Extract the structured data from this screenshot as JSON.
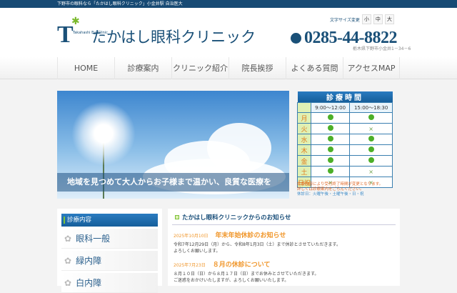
{
  "topbar": {
    "text": "下野市の眼科なら「たかはし眼科クリニック」小金井駅 自治医大"
  },
  "header": {
    "logo_letter": "T",
    "logo_small": "Takahashi EyeClinic",
    "clinic_name": "たかはし眼科クリニック",
    "font_size_label": "文字サイズ変更",
    "font_sizes": [
      "小",
      "中",
      "大"
    ],
    "phone": "0285-44-8822",
    "address": "栃木県下野市小金井1－34－6"
  },
  "nav": [
    "HOME",
    "診療案内",
    "クリニック紹介",
    "院長挨拶",
    "よくある質問",
    "アクセスMAP"
  ],
  "banner": {
    "text": "地域を見つめて大人からお子様まで温かい、良質な医療を"
  },
  "hours": {
    "title": "診療時間",
    "columns": [
      "9:00～12:00",
      "15:00～18:30"
    ],
    "rows": [
      {
        "day": "月",
        "am": "●",
        "pm": "●"
      },
      {
        "day": "火",
        "am": "●",
        "pm": "×"
      },
      {
        "day": "水",
        "am": "●",
        "pm": "●"
      },
      {
        "day": "木",
        "am": "●",
        "pm": "●"
      },
      {
        "day": "金",
        "am": "●",
        "pm": "●"
      },
      {
        "day": "土",
        "am": "●",
        "pm": "×"
      },
      {
        "day": "日祝",
        "am": "×",
        "pm": "×"
      }
    ],
    "note1": "診療内容により受付終了時間が変更となります。",
    "note2": "詳しくは診療案内をごらんください。",
    "holidays": "休診日：火曜午後・土曜午後・日・祝"
  },
  "sidebar": {
    "title": "診療内容",
    "items": [
      "眼科一般",
      "緑内障",
      "白内障"
    ]
  },
  "news": {
    "title": "たかはし眼科クリニックからのお知らせ",
    "entries": [
      {
        "date": "2025年10月10日",
        "title": "年末年始休診のお知らせ",
        "body1": "令和7年12月29日（月）から、令和8年1月3日（土）まで休診とさせていただきます。",
        "body2": "よろしくお願いします。"
      },
      {
        "date": "2025年7月23日",
        "title": "８月の休診について",
        "body1": "８月１０日（日）から８月１７日（日）までお休みとさせていただきます。",
        "body2": "ご迷惑をおかけいたしますが、よろしくお願いいたします。"
      }
    ]
  }
}
